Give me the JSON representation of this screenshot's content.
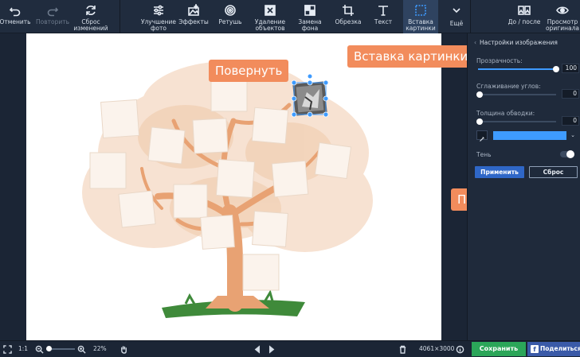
{
  "toolbar": {
    "undo": "Отменить",
    "redo": "Повторить",
    "reset_changes": "Сброс\nизменений",
    "enhance": "Улучшение\nфото",
    "effects": "Эффекты",
    "retouch": "Ретушь",
    "remove_objects": "Удаление\nобъектов",
    "replace_bg": "Замена\nфона",
    "crop": "Обрезка",
    "text": "Текст",
    "insert_image": "Вставка\nкартинки",
    "more": "Ещё",
    "before_after": "До / после",
    "view_original": "Просмотр\nоригинала"
  },
  "panel": {
    "header": "Настройки изображения",
    "opacity_label": "Прозрачность:",
    "opacity_value": "100",
    "corner_label": "Сглаживание углов:",
    "corner_value": "0",
    "border_label": "Толщина обводки:",
    "border_value": "0",
    "border_color": "#3e9bff",
    "shadow_label": "Тень",
    "apply": "Применить",
    "reset": "Сброс"
  },
  "callouts": {
    "rotate": "Повернуть",
    "insert": "Вставка картинки",
    "apply": "Применить"
  },
  "status": {
    "fit": "1:1",
    "zoom": "22%",
    "dimensions": "4061×3000",
    "save": "Сохранить",
    "share": "Поделиться"
  }
}
